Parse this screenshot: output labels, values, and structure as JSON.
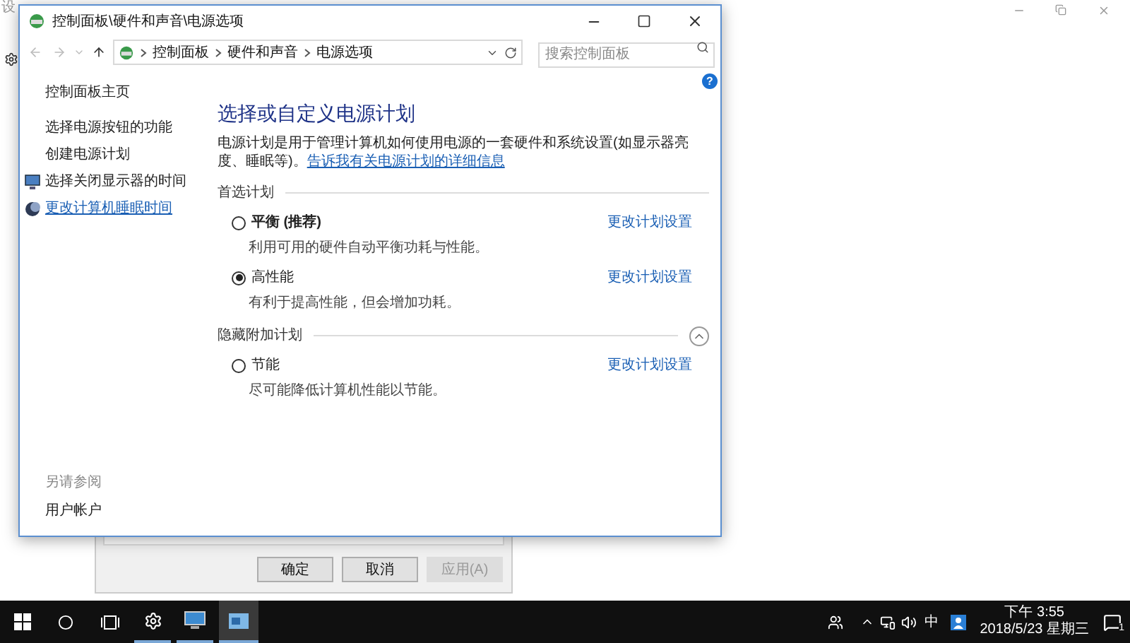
{
  "background_window": {
    "title": "设"
  },
  "help": {
    "glyph": "?"
  },
  "back_dialog": {
    "buttons": [
      {
        "label": "确定",
        "disabled": false
      },
      {
        "label": "取消",
        "disabled": false
      },
      {
        "label": "应用(A)",
        "disabled": true
      }
    ]
  },
  "window": {
    "title": "控制面板\\硬件和声音\\电源选项"
  },
  "address_bar": {
    "crumbs": [
      "控制面板",
      "硬件和声音",
      "电源选项"
    ]
  },
  "search": {
    "placeholder": "搜索控制面板"
  },
  "sidebar": {
    "home": "控制面板主页",
    "items": [
      {
        "label": "选择电源按钮的功能",
        "kind": "plain",
        "hovered": false
      },
      {
        "label": "创建电源计划",
        "kind": "plain",
        "hovered": false
      },
      {
        "label": "选择关闭显示器的时间",
        "kind": "monitor",
        "hovered": false
      },
      {
        "label": "更改计算机睡眠时间",
        "kind": "moon",
        "hovered": true
      }
    ],
    "see_also_heading": "另请参阅",
    "see_also": [
      "用户帐户"
    ]
  },
  "main": {
    "heading": "选择或自定义电源计划",
    "intro": "电源计划是用于管理计算机如何使用电源的一套硬件和系统设置(如显示器亮度、睡眠等)。",
    "intro_link": "告诉我有关电源计划的详细信息",
    "groups": [
      {
        "title": "首选计划",
        "kind": "plain",
        "plans": [
          {
            "name": "平衡 (推荐)",
            "bold": true,
            "selected": false,
            "description": "利用可用的硬件自动平衡功耗与性能。",
            "link": "更改计划设置"
          },
          {
            "name": "高性能",
            "bold": false,
            "selected": true,
            "description": "有利于提高性能，但会增加功耗。",
            "link": "更改计划设置"
          }
        ]
      },
      {
        "title": "隐藏附加计划",
        "kind": "collapsible",
        "expanded": true,
        "plans": [
          {
            "name": "节能",
            "bold": false,
            "selected": false,
            "description": "尽可能降低计算机性能以节能。",
            "link": "更改计划设置"
          }
        ]
      }
    ]
  },
  "taskbar": {
    "ime": "中",
    "time": "下午 3:55",
    "date": "2018/5/23 星期三",
    "notifications": "1"
  }
}
